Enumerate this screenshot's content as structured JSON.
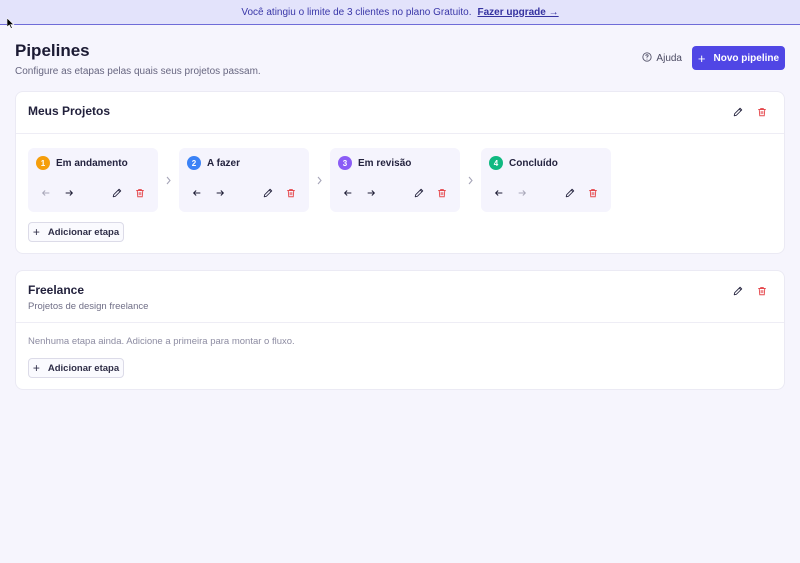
{
  "banner": {
    "message": "Você atingiu o limite de 3 clientes no plano Gratuito.",
    "link": "Fazer upgrade →"
  },
  "header": {
    "title": "Pipelines",
    "subtitle": "Configure as etapas pelas quais seus projetos passam.",
    "help_label": "Ajuda",
    "new_button_label": "Novo pipeline"
  },
  "pipelines": [
    {
      "name": "Meus Projetos",
      "description": "",
      "add_stage_label": "Adicionar etapa",
      "stages": [
        {
          "number": "1",
          "name": "Em andamento",
          "color": "#f59e0b"
        },
        {
          "number": "2",
          "name": "A fazer",
          "color": "#3b82f6"
        },
        {
          "number": "3",
          "name": "Em revisão",
          "color": "#8b5cf6"
        },
        {
          "number": "4",
          "name": "Concluído",
          "color": "#10b981"
        }
      ]
    },
    {
      "name": "Freelance",
      "description": "Projetos de design freelance",
      "empty_text": "Nenhuma etapa ainda. Adicione a primeira para montar o fluxo.",
      "add_stage_label": "Adicionar etapa",
      "stages": []
    }
  ],
  "icons": {
    "help": "help-circle-icon",
    "plus": "plus-icon",
    "edit": "pencil-icon",
    "delete": "trash-icon",
    "move_left": "arrow-left-icon",
    "move_right": "arrow-right-icon",
    "separator": "chevron-right-icon"
  },
  "colors": {
    "accent": "#5046e5",
    "danger": "#e5484d",
    "banner_bg": "#e3e3fb"
  }
}
